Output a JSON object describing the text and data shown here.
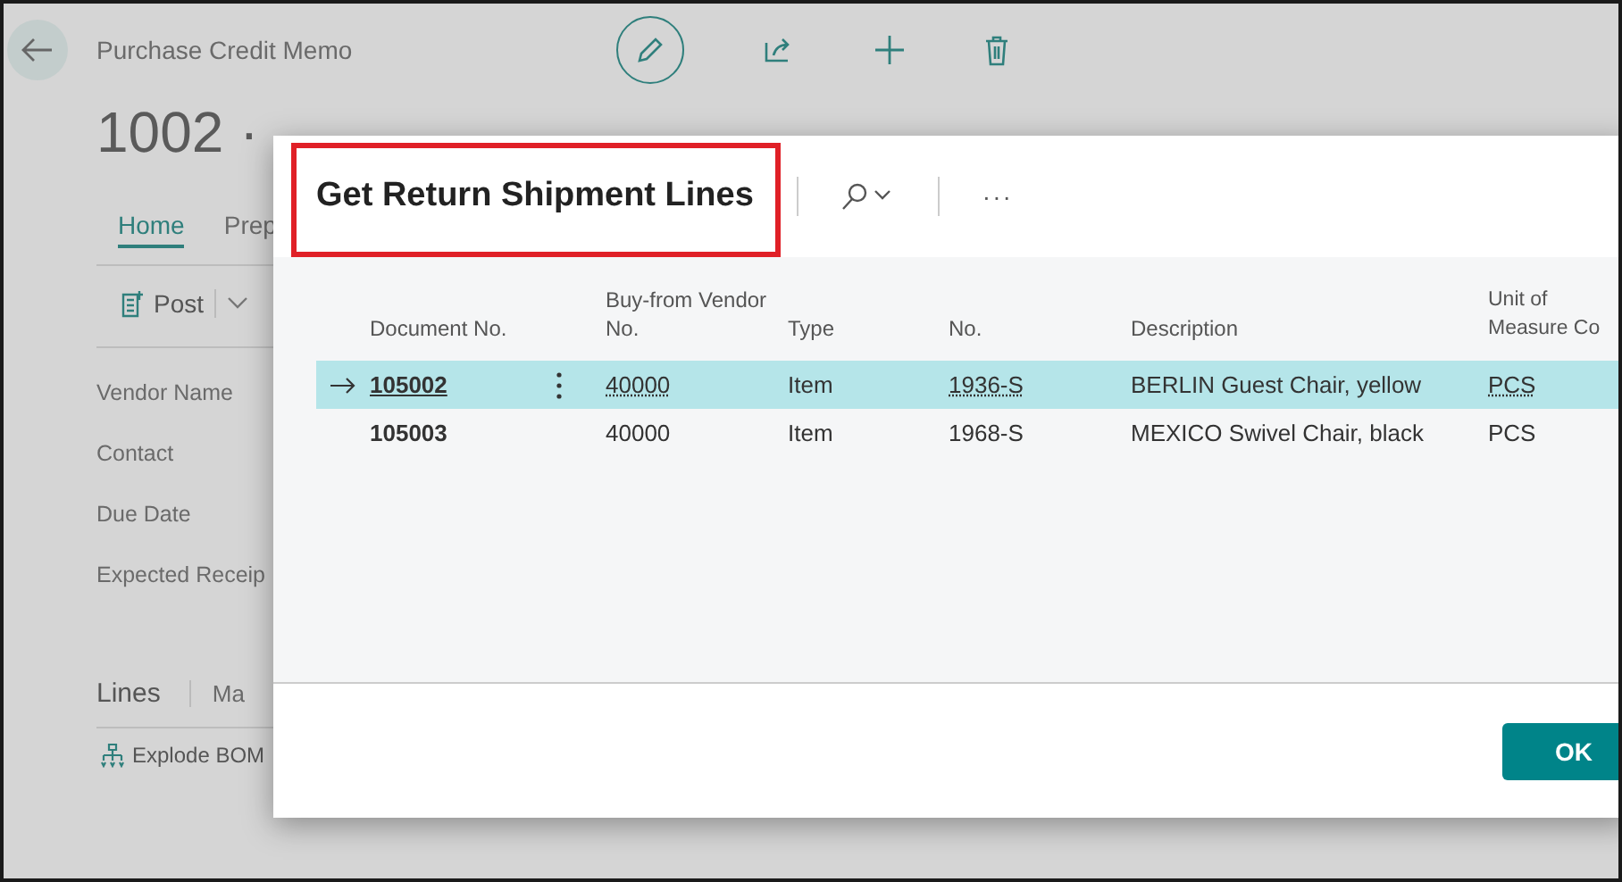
{
  "page": {
    "caption": "Purchase Credit Memo",
    "title": "1002 ·",
    "tabs": [
      {
        "label": "Home",
        "selected": true
      },
      {
        "label": "Prep",
        "selected": false
      }
    ],
    "actions": [
      {
        "label": "Post"
      }
    ],
    "fields": [
      "Vendor Name",
      "Contact",
      "Due Date",
      "Expected Receip"
    ],
    "lines_tabs": [
      {
        "label": "Lines",
        "selected": true
      },
      {
        "label": "Ma",
        "selected": false
      }
    ],
    "line_actions": [
      {
        "label": "Explode BOM"
      }
    ]
  },
  "dialog": {
    "title": "Get Return Shipment Lines",
    "more": "···",
    "columns": [
      {
        "label": "Document No."
      },
      {
        "label": "Buy-from Vendor No."
      },
      {
        "label": "Type"
      },
      {
        "label": "No."
      },
      {
        "label": "Description"
      },
      {
        "label": "Unit of Measure Co"
      }
    ],
    "rows": [
      {
        "selected": true,
        "cells": [
          "105002",
          "40000",
          "Item",
          "1936-S",
          "BERLIN Guest Chair, yellow",
          "PCS"
        ]
      },
      {
        "selected": false,
        "cells": [
          "105003",
          "40000",
          "Item",
          "1968-S",
          "MEXICO Swivel Chair, black",
          "PCS"
        ]
      }
    ],
    "ok": "OK"
  }
}
